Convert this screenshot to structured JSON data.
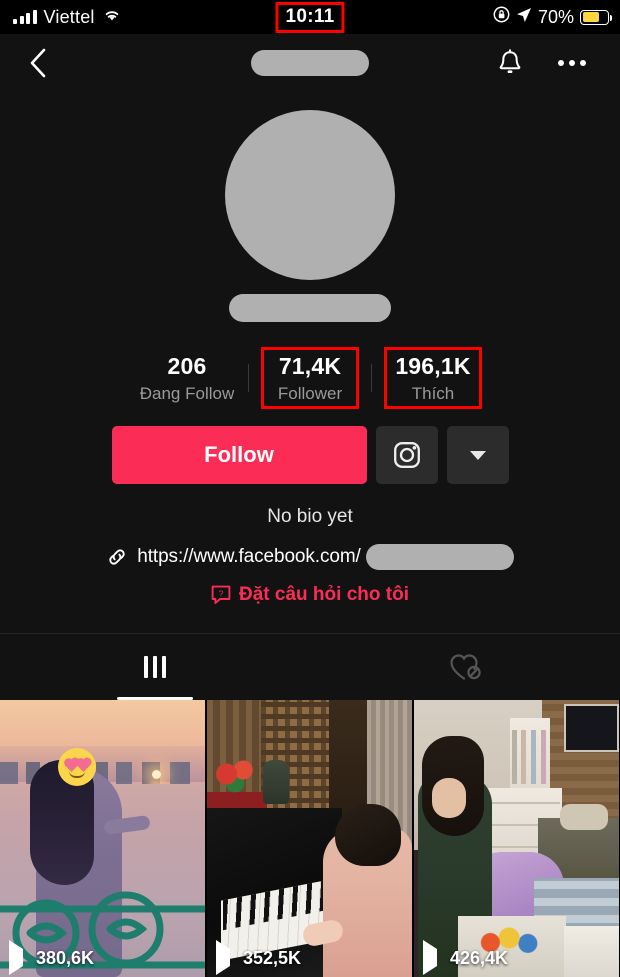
{
  "status_bar": {
    "carrier": "Viettel",
    "signal_icon": "cellular-signal-icon",
    "wifi_icon": "wifi-icon",
    "time": "10:11",
    "rotation_lock_icon": "rotation-lock-icon",
    "location_icon": "location-arrow-icon",
    "battery_percent": "70%",
    "battery_level": 70,
    "battery_color": "#FCD53F"
  },
  "nav": {
    "back_icon": "back-chevron-icon",
    "title_redacted": true,
    "bell_icon": "bell-icon",
    "more_icon": "more-options-icon"
  },
  "profile": {
    "avatar_redacted": true,
    "username_redacted": true,
    "stats": [
      {
        "value": "206",
        "label": "Đang Follow",
        "highlighted": false
      },
      {
        "value": "71,4K",
        "label": "Follower",
        "highlighted": true
      },
      {
        "value": "196,1K",
        "label": "Thích",
        "highlighted": true
      }
    ],
    "follow_button": {
      "label": "Follow",
      "color": "#FB2C55"
    },
    "instagram_icon": "instagram-icon",
    "dropdown_icon": "chevron-down-icon",
    "bio": "No bio yet",
    "link_icon": "link-icon",
    "link_text": "https://www.facebook.com/",
    "link_redacted": true,
    "question_icon": "question-bubble-icon",
    "question_label": "Đặt câu hỏi cho tôi",
    "question_color": "#FB2C55"
  },
  "tabs": [
    {
      "name": "videos",
      "icon": "grid-icon",
      "active": true
    },
    {
      "name": "liked",
      "icon": "heart-private-icon",
      "active": false
    }
  ],
  "videos": [
    {
      "views": "380,6K",
      "play_icon": "play-icon",
      "description": "sunset lakeside"
    },
    {
      "views": "352,5K",
      "play_icon": "play-icon",
      "description": "playing piano"
    },
    {
      "views": "426,4K",
      "play_icon": "play-icon",
      "description": "bedroom packing"
    }
  ],
  "annotations": {
    "box_color": "#FF0000",
    "boxed_items": [
      "time",
      "follower-stat",
      "likes-stat"
    ]
  }
}
